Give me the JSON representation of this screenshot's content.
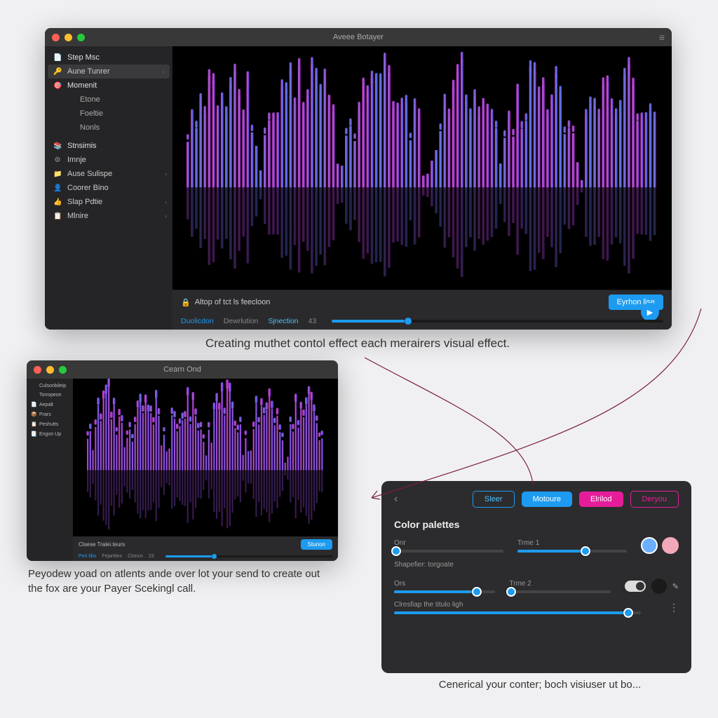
{
  "main_window": {
    "title": "Aveee Botayer",
    "sidebar": {
      "items": [
        {
          "icon": "📄",
          "label": "Step Msc",
          "type": "header"
        },
        {
          "icon": "🔑",
          "label": "Aune Tunrer",
          "type": "active",
          "chev": true
        },
        {
          "icon": "🎯",
          "label": "Momenit",
          "type": "header"
        },
        {
          "icon": "",
          "label": "Etone",
          "type": "sub"
        },
        {
          "icon": "",
          "label": "Foeltie",
          "type": "sub"
        },
        {
          "icon": "",
          "label": "Nonls",
          "type": "sub"
        },
        {
          "icon": "📚",
          "label": "Stnsimis",
          "type": "header",
          "gap": true
        },
        {
          "icon": "⚙",
          "label": "Imnje",
          "type": "item"
        },
        {
          "icon": "📁",
          "label": "Ause Sulispe",
          "type": "item",
          "chev": true
        },
        {
          "icon": "👤",
          "label": "Coorer Bino",
          "type": "item"
        },
        {
          "icon": "👍",
          "label": "Slap Pdtie",
          "type": "item",
          "chev": true
        },
        {
          "icon": "📋",
          "label": "Mlnire",
          "type": "item",
          "chev": true
        }
      ]
    },
    "info_label": "Altop of tct ls feecloon",
    "action_button": "Eyrhon lise",
    "tabs": [
      "Duolicdon",
      "Dewrlution",
      "Sjnection"
    ],
    "tab_number": "43",
    "progress_pct": 22
  },
  "caption_main": "Creating muthet contol effect each merairers visual effect.",
  "sec_window": {
    "title": "Cearn Ond",
    "sidebar": [
      {
        "label": "Culsonbileip"
      },
      {
        "label": "Torropeon"
      },
      {
        "label": "Aepalt",
        "icon": "📄"
      },
      {
        "label": "Prars",
        "icon": "📦"
      },
      {
        "label": "Peshutts",
        "icon": "📋"
      },
      {
        "label": "Engon Up",
        "icon": "📑"
      }
    ],
    "info_label": "Clsese Tralei.teurs",
    "action_button": "Sturion",
    "tabs": [
      "Peri tibs",
      "Fejartites",
      "Cloncn"
    ],
    "tab_number": "23",
    "progress_pct": 28
  },
  "caption_sec": "Peyodew yoad on atlents ande over lot your send to create out the fox are your Payer Scekingl call.",
  "panel": {
    "buttons": [
      "Sleer",
      "Motoure",
      "Elrilod",
      "Deryou"
    ],
    "heading": "Color palettes",
    "sliders": [
      {
        "label_a": "Onr",
        "val_a": 1,
        "label_b": "Trme 1",
        "val_b": 62
      },
      {
        "label_a": "Ors",
        "val_a": 82,
        "label_b": "Trme 2",
        "val_b": 3
      }
    ],
    "label_shape": "Shapefier: torgoate",
    "checkbox_label": "Clresfiap the titulo ligh",
    "checkbox_slider_val": 95,
    "swatch1": "#6ab0ff",
    "swatch2": "#f2a8b8",
    "swatch3": "#1a1a1a"
  },
  "caption_panel": "Cenerical your conter; boch visiuser ut bo..."
}
